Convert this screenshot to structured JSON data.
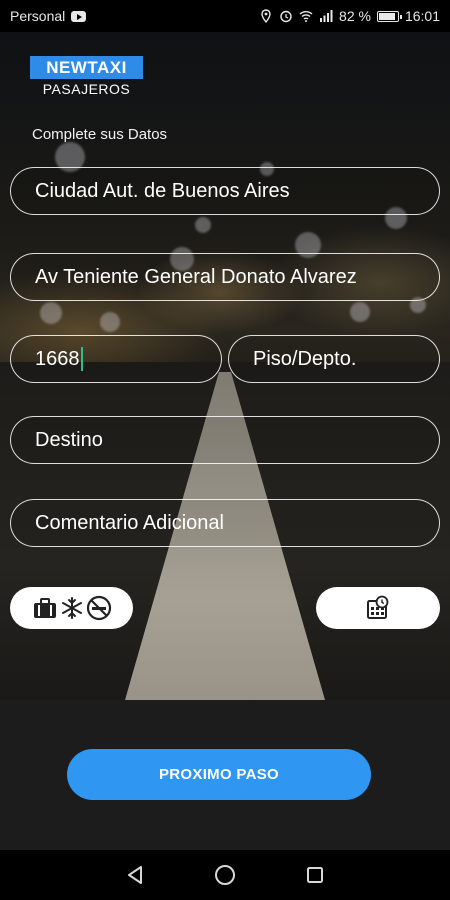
{
  "status_bar": {
    "carrier": "Personal",
    "battery": "82 %",
    "time": "16:01",
    "icons": [
      "youtube-icon",
      "location-icon",
      "alarm-icon",
      "wifi-icon",
      "signal-icon",
      "battery-icon"
    ]
  },
  "logo": {
    "top": "NEWTAXI",
    "bottom": "PASAJEROS"
  },
  "form": {
    "subtitle": "Complete sus Datos",
    "city": "Ciudad Aut. de Buenos Aires",
    "street": "Av Teniente General Donato Alvarez",
    "number": "1668",
    "floor_placeholder": "Piso/Depto.",
    "destination_placeholder": "Destino",
    "comment_placeholder": "Comentario Adicional"
  },
  "options": {
    "left_icons": [
      "suitcase-icon",
      "snowflake-icon",
      "no-smoking-icon"
    ],
    "right_icons": [
      "calendar-clock-icon"
    ]
  },
  "footer": {
    "next_label": "PROXIMO PASO"
  },
  "colors": {
    "accent": "#2f96f1",
    "logo_blue": "#2f8be8",
    "cursor": "#27c08e"
  }
}
